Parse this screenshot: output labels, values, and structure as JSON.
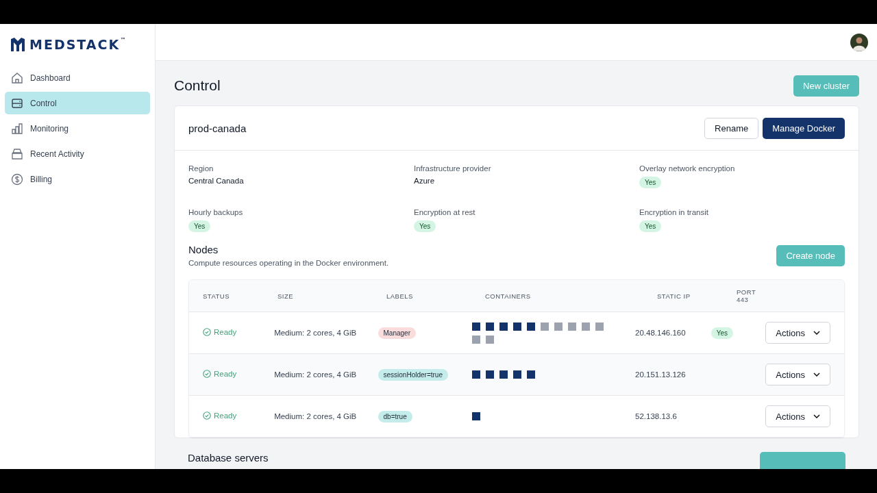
{
  "brand": {
    "name": "MEDSTACK",
    "mark": "™"
  },
  "sidebar": {
    "items": [
      {
        "label": "Dashboard",
        "kind": "home",
        "selected": false
      },
      {
        "label": "Control",
        "kind": "server",
        "selected": true
      },
      {
        "label": "Monitoring",
        "kind": "chart",
        "selected": false
      },
      {
        "label": "Recent Activity",
        "kind": "stack",
        "selected": false
      },
      {
        "label": "Billing",
        "kind": "dollar",
        "selected": false
      }
    ]
  },
  "page": {
    "title": "Control",
    "new_button": "New cluster"
  },
  "cluster": {
    "name": "prod-canada",
    "rename_button": "Rename",
    "manage_button": "Manage Docker",
    "fields": [
      {
        "label": "Region",
        "value": "Central Canada",
        "kind": "text"
      },
      {
        "label": "Infrastructure provider",
        "value": "Azure",
        "kind": "text"
      },
      {
        "label": "Overlay network encryption",
        "value": "Yes",
        "kind": "badge"
      },
      {
        "label": "Hourly backups",
        "value": "Yes",
        "kind": "badge"
      },
      {
        "label": "Encryption at rest",
        "value": "Yes",
        "kind": "badge"
      },
      {
        "label": "Encryption in transit",
        "value": "Yes",
        "kind": "badge"
      }
    ]
  },
  "nodes": {
    "title": "Nodes",
    "description": "Compute resources operating in the Docker environment.",
    "create_button": "Create node",
    "columns": [
      "STATUS",
      "SIZE",
      "LABELS",
      "CONTAINERS",
      "STATIC IP",
      "PORT 443"
    ],
    "rows": [
      {
        "status": "Ready",
        "size": "Medium: 2 cores, 4 GiB",
        "label": "Manager",
        "color": "#fadcdc",
        "containers": [
          {
            "active": true
          },
          {
            "active": true
          },
          {
            "active": true
          },
          {
            "active": true
          },
          {
            "active": true
          },
          {
            "active": false
          },
          {
            "active": false
          },
          {
            "active": false
          },
          {
            "active": false
          },
          {
            "active": false
          },
          {
            "active": false
          },
          {
            "active": false
          }
        ],
        "ip": "20.48.146.160",
        "port": "Yes",
        "actions": "Actions"
      },
      {
        "status": "Ready",
        "size": "Medium: 2 cores, 4 GiB",
        "label": "sessionHolder=true",
        "color": "#c4ecea",
        "containers": [
          {
            "active": true
          },
          {
            "active": true
          },
          {
            "active": true
          },
          {
            "active": true
          },
          {
            "active": true
          }
        ],
        "ip": "20.151.13.126",
        "actions": "Actions"
      },
      {
        "status": "Ready",
        "size": "Medium: 2 cores, 4 GiB",
        "label": "db=true",
        "color": "#c4ecea",
        "containers": [
          {
            "active": true
          }
        ],
        "ip": "52.138.13.6",
        "actions": "Actions"
      }
    ]
  },
  "databases": {
    "title": "Database servers"
  }
}
